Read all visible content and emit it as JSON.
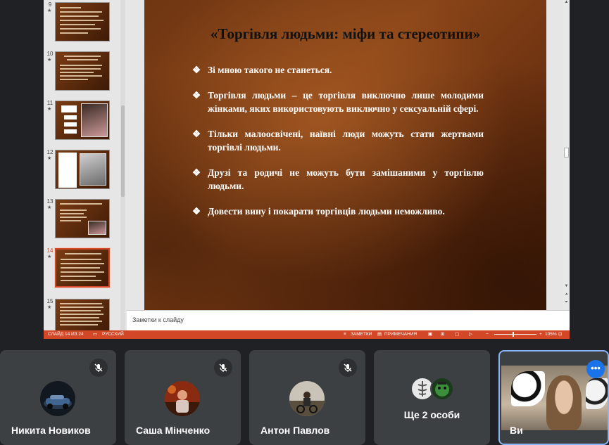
{
  "presentation": {
    "thumbnails": [
      {
        "num": "9",
        "star": "★",
        "active": false
      },
      {
        "num": "10",
        "star": "★",
        "active": false
      },
      {
        "num": "11",
        "star": "★",
        "active": false
      },
      {
        "num": "12",
        "star": "★",
        "active": false
      },
      {
        "num": "13",
        "star": "★",
        "active": false
      },
      {
        "num": "14",
        "star": "★",
        "active": true
      },
      {
        "num": "15",
        "star": "★",
        "active": false
      }
    ],
    "slide": {
      "title": "«Торгівля людьми: міфи та стереотипи»",
      "bullet_mark": "❖",
      "bullets": [
        "Зі мною такого не станеться.",
        "Торгівля людьми – це торгівля виключно лише молодими жінками, яких використовують виключно у сексуальній сфері.",
        "Тільки малоосвічені, наївні люди можуть стати жертвами торгівлі людьми.",
        "Друзі та родичі не можуть бути замішаними у торгівлю людьми.",
        "Довести вину і покарати торгівців людьми неможливо."
      ]
    },
    "notes_placeholder": "Заметки к слайду",
    "statusbar": {
      "slide_counter": "СЛАЙД 14 ИЗ 24",
      "language": "РУССКИЙ",
      "notes_button": "ЗАМЕТКИ",
      "comments_button": "ПРИМЕЧАНИЯ",
      "zoom_minus": "−",
      "zoom_plus": "+",
      "zoom_level": "105%"
    }
  },
  "participants": [
    {
      "name": "Никита Новиков",
      "muted": true,
      "avatar": "car-photo"
    },
    {
      "name": "Саша Мінченко",
      "muted": true,
      "avatar": "person-photo"
    },
    {
      "name": "Антон Павлов",
      "muted": true,
      "avatar": "motorbike-photo"
    }
  ],
  "more_tile": {
    "label": "Ще 2 особи"
  },
  "self_tile": {
    "name": "Ви",
    "menu_icon": "•••"
  },
  "icons": {
    "mic_off": "mic-off-icon"
  },
  "colors": {
    "accent": "#d24726",
    "meet_bg": "#202124",
    "tile_bg": "#3c4043",
    "self_border": "#8ab4f8"
  }
}
